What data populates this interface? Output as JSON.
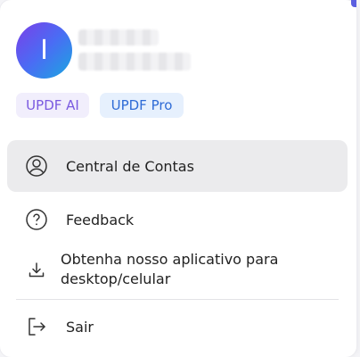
{
  "user": {
    "avatar_initial": "I",
    "name_redacted": "",
    "email_redacted": ""
  },
  "plans": {
    "ai_label": "UPDF AI",
    "pro_label": "UPDF Pro"
  },
  "menu": {
    "account_label": "Central de Contas",
    "feedback_label": "Feedback",
    "download_label_line1": "Obtenha nosso aplicativo para",
    "download_label_line2": "desktop/celular",
    "logout_label": "Sair"
  },
  "colors": {
    "avatar_gradient": [
      "#7b3fe8",
      "#4a6cf4",
      "#1aa7e0"
    ],
    "ai_chip_text": "#7a5ae0",
    "pro_chip_text": "#2e6bd6",
    "active_item_bg": "#ebebed"
  }
}
